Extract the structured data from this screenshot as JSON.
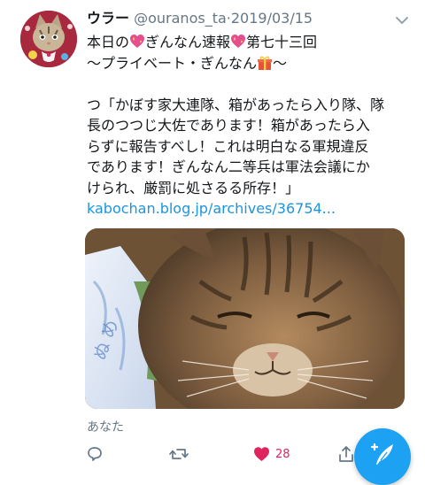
{
  "tweet": {
    "display_name": "ウラー",
    "handle": "@ouranos_ta",
    "separator": "·",
    "date": "2019/03/15",
    "text": {
      "line1_a": "本日の",
      "line1_b": "ぎんなん速報",
      "line1_c": "第七十三回",
      "line2_a": "〜プライベート・ぎんなん",
      "line2_b": "〜",
      "body_lines": [
        "つ「かぼす家大連隊、箱があったら入り隊、隊",
        "長のつつじ大佐であります！箱があったら入",
        "らずに報告すべし！これは明白なる軍規違反",
        "であります！ぎんなん二等兵は軍法会議にか",
        "けられ、厳罰に処さるる所存！」"
      ],
      "link": "kabochan.blog.jp/archives/36754..."
    },
    "reply_context": "あなた",
    "like_count": "28"
  },
  "icons": {
    "caret": "chevron-down-icon",
    "reply": "reply-icon",
    "retweet": "retweet-icon",
    "like": "heart-icon",
    "share": "share-icon",
    "compose": "compose-tweet-icon",
    "emoji_heart": "sparkling-heart-emoji",
    "emoji_gift": "gift-emoji"
  },
  "colors": {
    "accent": "#1da1f2",
    "link": "#1b95e0",
    "like": "#e0245e",
    "muted": "#657786"
  }
}
